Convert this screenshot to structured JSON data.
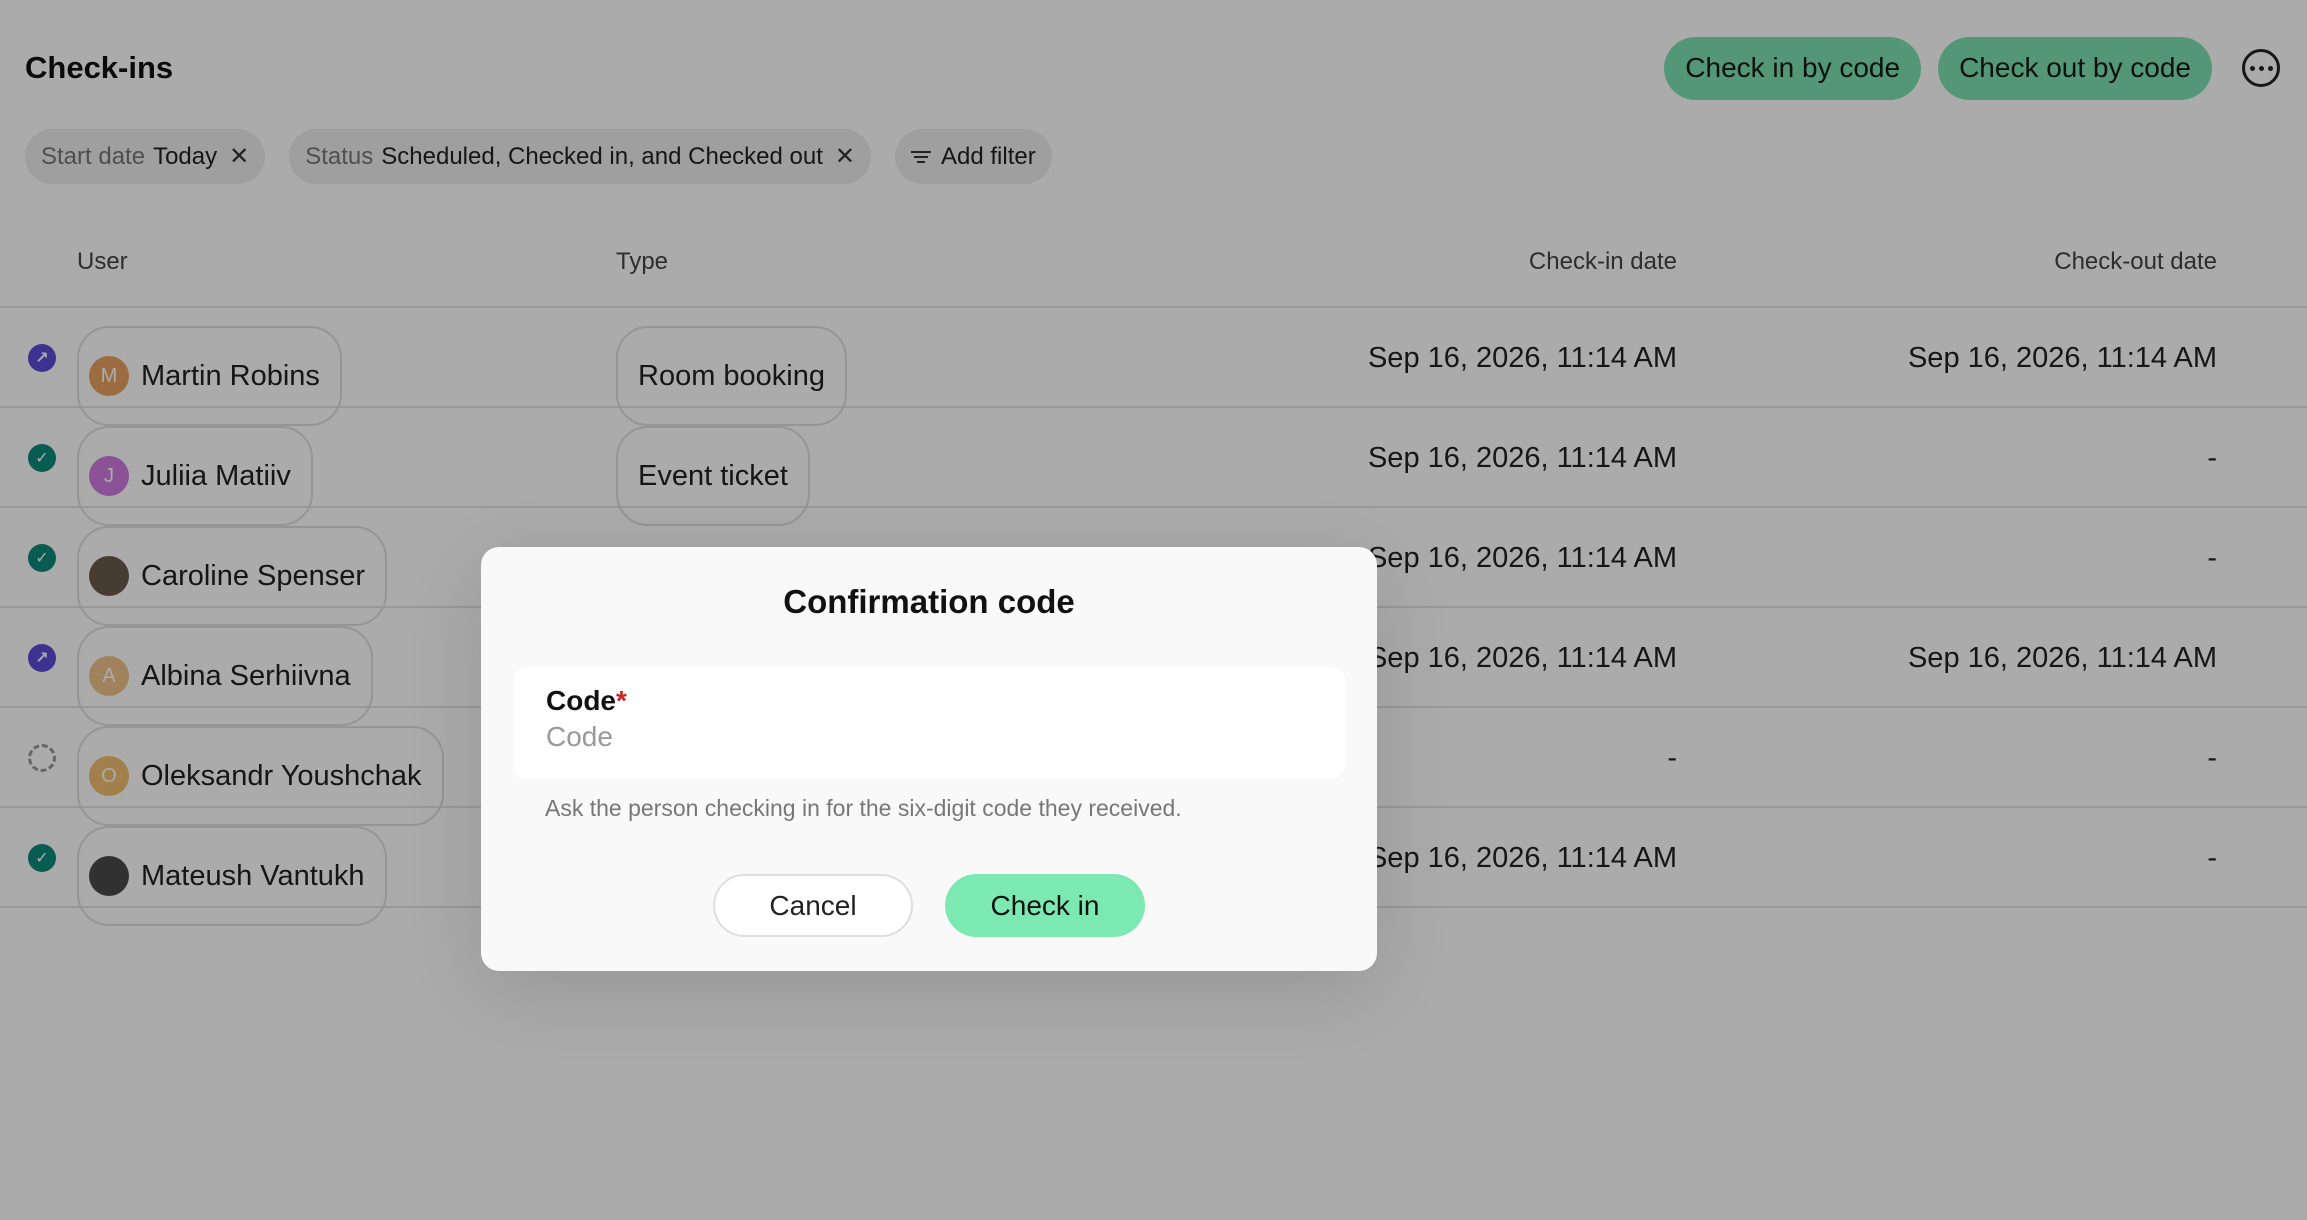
{
  "header": {
    "title": "Check-ins",
    "check_in_by_code": "Check in by code",
    "check_out_by_code": "Check out by code",
    "more_icon": "more-horizontal-icon"
  },
  "filters": [
    {
      "key": "Start date",
      "value": "Today"
    },
    {
      "key": "Status",
      "value": "Scheduled, Checked in, and Checked out"
    },
    {
      "label": "Add filter"
    }
  ],
  "table": {
    "columns": [
      "User",
      "Type",
      "Check-in date",
      "Check-out date"
    ],
    "rows": [
      {
        "status": "checked-out",
        "status_color": "#5b4bd6",
        "avatar_letter": "M",
        "avatar_color": "#e8a15e",
        "user": "Martin Robins",
        "type": "Room booking",
        "check_in": "Sep 16, 2026, 11:14 AM",
        "check_out": "Sep 16, 2026, 11:14 AM"
      },
      {
        "status": "checked-in",
        "status_color": "#0e8a7a",
        "avatar_letter": "J",
        "avatar_color": "#cf7de0",
        "user": "Juliia Matiiv",
        "type": "Event ticket",
        "check_in": "Sep 16, 2026, 11:14 AM",
        "check_out": "-"
      },
      {
        "status": "checked-in",
        "status_color": "#0e8a7a",
        "avatar_letter": "",
        "avatar_color": "#6b5a4a",
        "user": "Caroline Spenser",
        "type": "",
        "check_in": "Sep 16, 2026, 11:14 AM",
        "check_out": "-"
      },
      {
        "status": "checked-out",
        "status_color": "#5b4bd6",
        "avatar_letter": "A",
        "avatar_color": "#efc48a",
        "user": "Albina Serhiivna",
        "type": "",
        "check_in": "Sep 16, 2026, 11:14 AM",
        "check_out": "Sep 16, 2026, 11:14 AM"
      },
      {
        "status": "scheduled",
        "status_color": "#999999",
        "avatar_letter": "O",
        "avatar_color": "#f0bf72",
        "user": "Oleksandr Youshchak",
        "type": "",
        "check_in": "-",
        "check_out": "-"
      },
      {
        "status": "checked-in",
        "status_color": "#0e8a7a",
        "avatar_letter": "",
        "avatar_color": "#4a4a4a",
        "user": "Mateush Vantukh",
        "type": "",
        "check_in": "Sep 16, 2026, 11:14 AM",
        "check_out": "-"
      }
    ]
  },
  "modal": {
    "title": "Confirmation code",
    "field_label": "Code",
    "required_mark": "*",
    "placeholder": "Code",
    "value": "",
    "helper": "Ask the person checking in for the six-digit code they received.",
    "cancel_label": "Cancel",
    "confirm_label": "Check in"
  }
}
